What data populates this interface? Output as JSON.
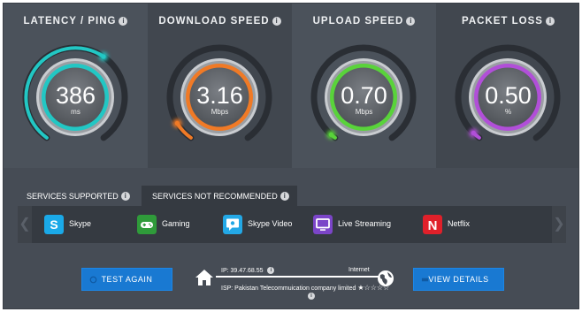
{
  "colors": {
    "latency": "#22c7c4",
    "download": "#f07a26",
    "upload": "#59d33a",
    "packet_loss": "#b14fd8",
    "button": "#1979d2"
  },
  "metrics": [
    {
      "title": "LATENCY / PING",
      "value": "386",
      "unit": "ms",
      "fill": 0.62
    },
    {
      "title": "DOWNLOAD SPEED",
      "value": "3.16",
      "unit": "Mbps",
      "fill": 0.08
    },
    {
      "title": "UPLOAD SPEED",
      "value": "0.70",
      "unit": "Mbps",
      "fill": 0.02
    },
    {
      "title": "PACKET LOSS",
      "value": "0.50",
      "unit": "%",
      "fill": 0.03
    }
  ],
  "tabs": [
    {
      "label": "SERVICES SUPPORTED"
    },
    {
      "label": "SERVICES NOT RECOMMENDED"
    }
  ],
  "services": [
    {
      "label": "Skype",
      "icon": "skype-icon",
      "color": "#1aa9e8"
    },
    {
      "label": "Gaming",
      "icon": "gamepad-icon",
      "color": "#2f9b3a"
    },
    {
      "label": "Skype Video",
      "icon": "video-chat-icon",
      "color": "#23a8e6"
    },
    {
      "label": "Live Streaming",
      "icon": "monitor-icon",
      "color": "#7b45c8"
    },
    {
      "label": "Netflix",
      "icon": "netflix-icon",
      "color": "#e0202a"
    }
  ],
  "buttons": {
    "test_again": "TEST AGAIN",
    "view_details": "VIEW DETAILS"
  },
  "connection": {
    "ip": "IP: 39.47.68.55",
    "internet": "Internet",
    "isp": "ISP: Pakistan Telecommuication company limited",
    "rating": 1,
    "rating_max": 5
  }
}
